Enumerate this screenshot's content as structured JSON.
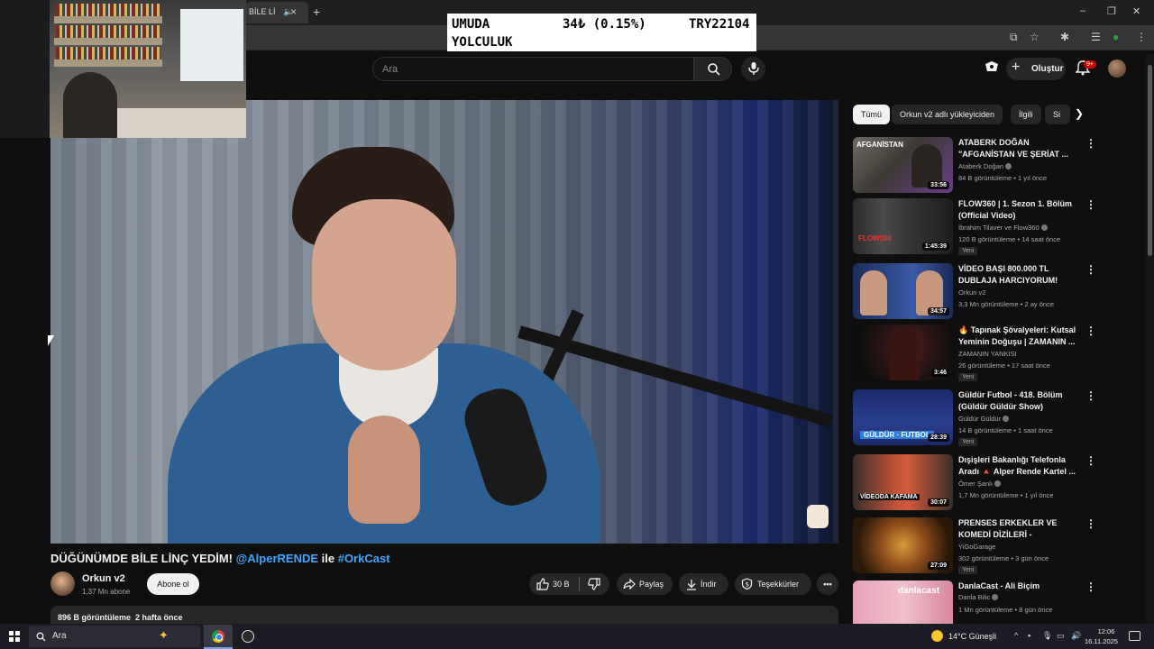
{
  "browser": {
    "tab_title": "BİLE Lİ",
    "tab_close": "×",
    "new_tab": "+",
    "window_controls": [
      "–",
      "❐",
      "✕"
    ]
  },
  "ticker": {
    "name_line1": "UMUDA",
    "name_line2": "YOLCULUK",
    "change": "34₺ (0.15%)",
    "price": "TRY22104"
  },
  "header": {
    "search_placeholder": "Ara",
    "create_label": "Oluştur",
    "notification_count": "9+"
  },
  "video": {
    "title_part1": "DÜĞÜNÜMDE BİLE LİNÇ YEDİM! ",
    "title_mention": "@AlperRENDE",
    "title_part2": " ile ",
    "title_hashtag": "#OrkCast",
    "channel_name": "Orkun v2",
    "channel_subs": "1,37 Mn abone",
    "subscribe_label": "Abone ol",
    "like_count": "30 B",
    "share_label": "Paylaş",
    "download_label": "İndir",
    "thanks_label": "Teşekkürler",
    "more_label": "•••",
    "views": "896 B görüntüleme",
    "posted": "2 hafta önce"
  },
  "chips": [
    {
      "label": "Tümü",
      "active": true
    },
    {
      "label": "Orkun v2 adlı yükleyiciden",
      "active": false
    },
    {
      "label": "İlgili",
      "active": false
    },
    {
      "label": "Si",
      "active": false
    }
  ],
  "recommendations": [
    {
      "title": "ATABERK DOĞAN \"AFGANİSTAN VE ŞERİAT ...",
      "channel": "Ataberk Doğan",
      "verified": true,
      "meta": "84 B görüntüleme • 1 yıl önce",
      "duration": "33:56",
      "new": ""
    },
    {
      "title": "FLOW360 | 1. Sezon 1. Bölüm (Official Video)",
      "channel": "İbrahim Tilaver ve Flow360",
      "verified": true,
      "meta": "120 B görüntüleme • 14 saat önce",
      "duration": "1:45:39",
      "new": "Yeni"
    },
    {
      "title": "VİDEO BAŞI 800.000 TL DUBLAJA HARCIYORUM! Ruhi...",
      "channel": "Orkun v2",
      "verified": false,
      "meta": "3,3 Mn görüntüleme • 2 ay önce",
      "duration": "34:57",
      "new": ""
    },
    {
      "title": "🔥 Tapınak Şövalyeleri: Kutsal Yeminin Doğuşu | ZAMANIN ...",
      "channel": "ZAMANIN YANKISI",
      "verified": false,
      "meta": "26 görüntüleme • 17 saat önce",
      "duration": "3:46",
      "new": "Yeni"
    },
    {
      "title": "Güldür Futbol - 418. Bölüm (Güldür Güldür Show)",
      "channel": "Güldür Güldür",
      "verified": true,
      "meta": "14 B görüntüleme • 1 saat önce",
      "duration": "28:39",
      "new": "Yeni"
    },
    {
      "title": "Dışişleri Bakanlığı Telefonla Aradı 🔺 Alper Rende Kartel ...",
      "channel": "Ömer Şanlı",
      "verified": true,
      "meta": "1,7 Mn görüntüleme • 1 yıl önce",
      "duration": "30:07",
      "new": ""
    },
    {
      "title": "PRENSES ERKEKLER VE KOMEDİ DİZİLERİ - LoudSessi...",
      "channel": "YiGoGarage",
      "verified": false,
      "meta": "302 görüntüleme • 3 gün önce",
      "duration": "27:09",
      "new": "Yeni"
    },
    {
      "title": "DanlaCast - Ali Biçim",
      "channel": "Danla Bilic",
      "verified": true,
      "meta": "1 Mn görüntüleme • 8 gün önce",
      "duration": "",
      "new": ""
    }
  ],
  "taskbar": {
    "search_label": "Ara",
    "weather": "14°C  Güneşli",
    "time": "12:06",
    "date": "16.11.2025"
  },
  "icons": {
    "search": "search-icon",
    "mic": "mic-icon",
    "bell": "bell-icon",
    "cast": "cast-icon",
    "like": "thumbs-up-icon",
    "dislike": "thumbs-down-icon",
    "share": "share-icon",
    "download": "download-icon",
    "thanks": "thanks-icon"
  },
  "colors": {
    "background": "#0f0f0f",
    "link": "#3ea6ff",
    "chip_active": "#f1f1f1",
    "surface": "#272727"
  }
}
